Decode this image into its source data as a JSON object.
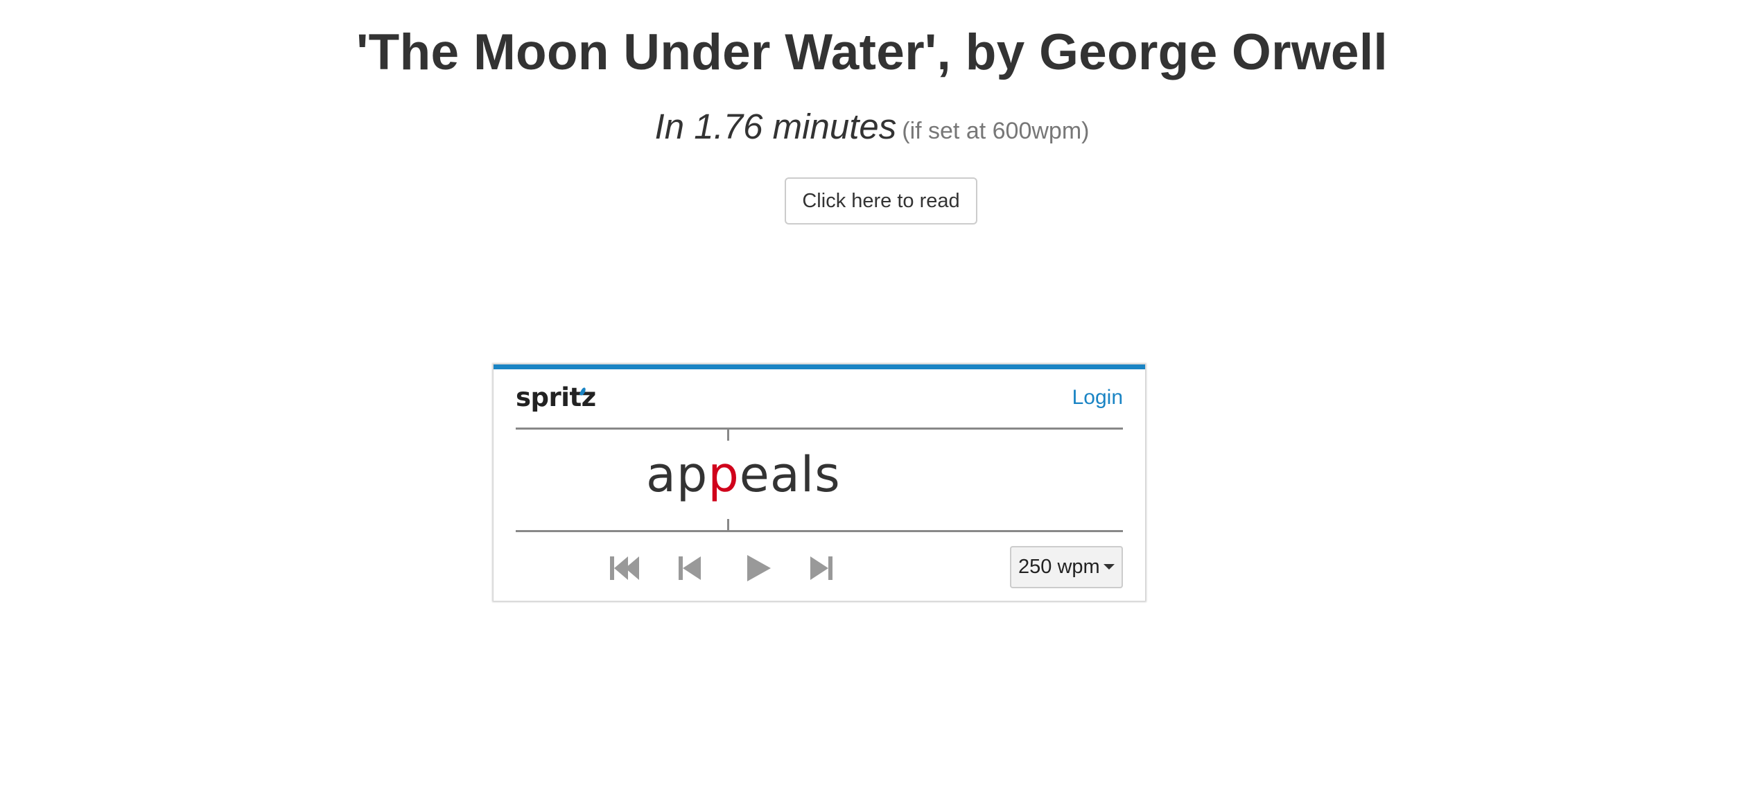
{
  "page": {
    "title": "'The Moon Under Water', by George Orwell",
    "reading_time": "In 1.76 minutes",
    "reading_time_note": "(if set at 600wpm)",
    "read_button_label": "Click here to read"
  },
  "spritz": {
    "logo_text": "spritz",
    "login_label": "Login",
    "word": {
      "before": "ap",
      "pivot": "p",
      "after": "eals"
    },
    "controls": [
      "rewind-to-start-icon",
      "back-icon",
      "play-icon",
      "forward-icon"
    ],
    "speed_label": "250 wpm",
    "accent_color": "#1a84c4",
    "pivot_color": "#d0021b"
  }
}
